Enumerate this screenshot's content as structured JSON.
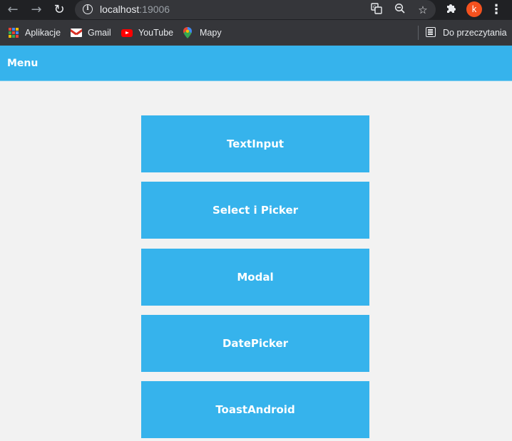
{
  "browser": {
    "url_host": "localhost",
    "url_port": ":19006",
    "avatar_letter": "k",
    "icons": {
      "back": "back-arrow-icon",
      "forward": "forward-arrow-icon",
      "reload": "reload-icon",
      "site_info": "info-icon",
      "translate": "translate-icon",
      "zoom": "zoom-out-icon",
      "bookmark": "star-icon",
      "extensions": "puzzle-icon",
      "menu": "kebab-menu-icon"
    }
  },
  "bookmarks": {
    "items": [
      {
        "label": "Aplikacje",
        "icon": "apps-grid-icon"
      },
      {
        "label": "Gmail",
        "icon": "gmail-icon"
      },
      {
        "label": "YouTube",
        "icon": "youtube-icon"
      },
      {
        "label": "Mapy",
        "icon": "maps-icon"
      }
    ],
    "reading_list": {
      "label": "Do przeczytania",
      "icon": "reading-list-icon"
    }
  },
  "app": {
    "header_title": "Menu",
    "accent_color": "#36b3ec",
    "background_color": "#f2f2f2",
    "menu_items": [
      {
        "label": "TextInput"
      },
      {
        "label": "Select i Picker"
      },
      {
        "label": "Modal"
      },
      {
        "label": "DatePicker"
      },
      {
        "label": "ToastAndroid"
      }
    ]
  }
}
